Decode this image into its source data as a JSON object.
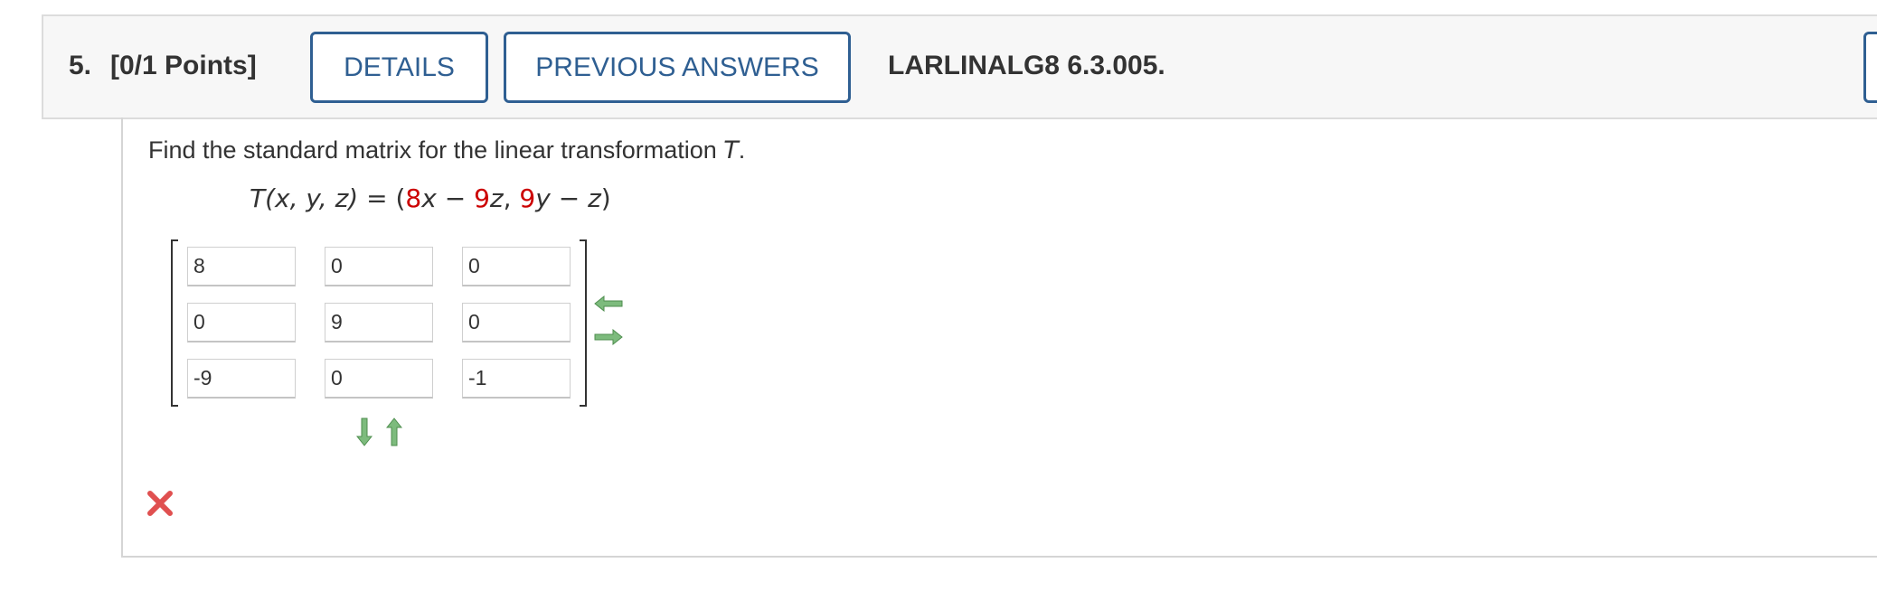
{
  "header": {
    "number": "5.",
    "points": "[0/1 Points]",
    "details_label": "DETAILS",
    "previous_answers_label": "PREVIOUS ANSWERS",
    "reference": "LARLINALG8 6.3.005."
  },
  "question": {
    "prompt_text": "Find the standard matrix for the linear transformation ",
    "prompt_var": "T",
    "prompt_end": ".",
    "eq_lhs": "T(x, y, z)",
    "eq_equals": " = (",
    "eq_coef1": "8",
    "eq_var1": "x",
    "eq_minus1": " − ",
    "eq_coef2": "9",
    "eq_var2": "z",
    "eq_comma": ", ",
    "eq_coef3": "9",
    "eq_var3": "y",
    "eq_minus2": " − ",
    "eq_var4": "z",
    "eq_close": ")"
  },
  "matrix": {
    "rows": [
      [
        "8",
        "0",
        "0"
      ],
      [
        "0",
        "9",
        "0"
      ],
      [
        "-9",
        "0",
        "-1"
      ]
    ]
  },
  "status": {
    "result": "incorrect",
    "mark_color": "#e05050"
  },
  "colors": {
    "accent": "#2f5f92",
    "highlight": "#cc0000",
    "arrow_green": "#5fa05f"
  }
}
